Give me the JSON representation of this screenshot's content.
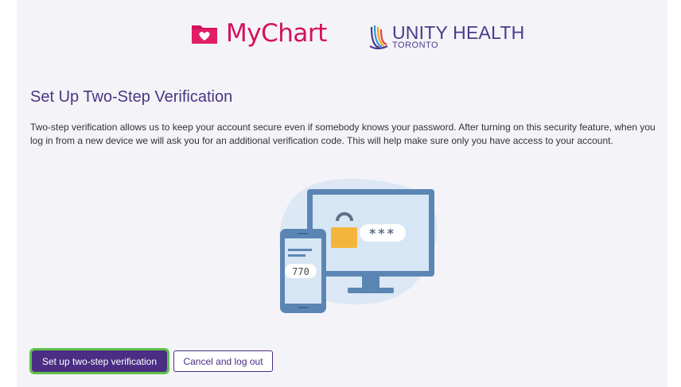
{
  "header": {
    "mychart_logo_text": "MyChart",
    "unity_logo_line1": "UNITY HEALTH",
    "unity_logo_line2": "TORONTO"
  },
  "main": {
    "title": "Set Up Two-Step Verification",
    "description": "Two-step verification allows us to keep your account secure even if somebody knows your password. After turning on this security feature, when you log in from a new device we will ask you for an additional verification code. This will help make sure only you have access to your account.",
    "illustration": {
      "password_mask": "***",
      "phone_code": "770"
    }
  },
  "actions": {
    "primary_label": "Set up two-step verification",
    "secondary_label": "Cancel and log out"
  },
  "colors": {
    "mychart_pink": "#d4115b",
    "brand_purple": "#4b2e83",
    "focus_green": "#5fc14a",
    "panel_bg": "#f4f3f8"
  }
}
